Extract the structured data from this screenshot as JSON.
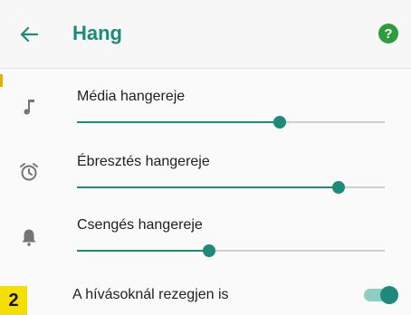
{
  "app_bar": {
    "title": "Hang",
    "help_glyph": "?",
    "back_icon": "back-arrow-icon",
    "help_icon": "help-icon"
  },
  "sliders": [
    {
      "label": "Média hangereje",
      "value": 0.66,
      "icon": "music-note-icon"
    },
    {
      "label": "Ébresztés hangereje",
      "value": 0.85,
      "icon": "alarm-clock-icon"
    },
    {
      "label": "Csengés hangereje",
      "value": 0.43,
      "icon": "bell-icon"
    }
  ],
  "toggle": {
    "label": "A hívásoknál rezegjen is",
    "checked": true
  },
  "step_badge": "2",
  "colors": {
    "accent": "#1e8a7a",
    "help": "#2e9c3c",
    "badge": "#f5df00"
  }
}
